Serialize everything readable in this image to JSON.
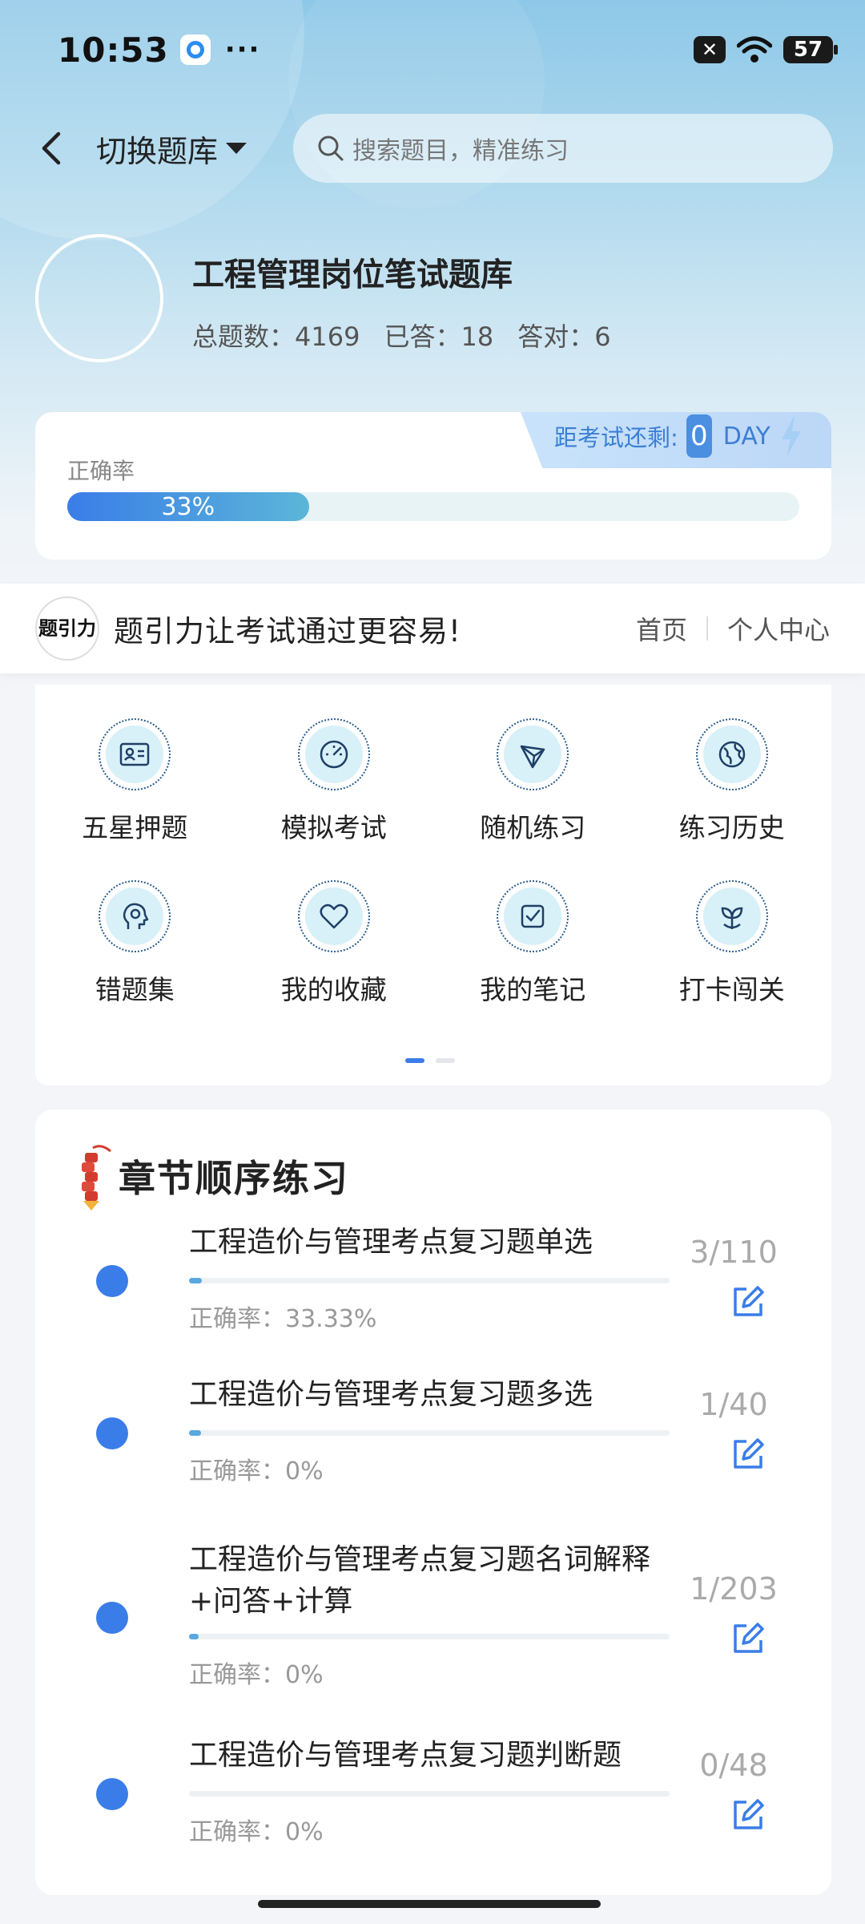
{
  "status": {
    "time": "10:53",
    "dots": "···",
    "battery": "57"
  },
  "nav": {
    "switch_label": "切换题库",
    "search_placeholder": "搜索题目，精准练习"
  },
  "bank": {
    "title": "工程管理岗位笔试题库",
    "total_label": "总题数：4169",
    "answered_label": "已答：18",
    "correct_label": "答对：6"
  },
  "accuracy": {
    "label": "正确率",
    "value_text": "33%",
    "value": 0.33,
    "countdown_label": "距考试还剩:",
    "countdown_num": "0",
    "countdown_unit": "DAY"
  },
  "brand": {
    "logo_text": "题引力",
    "slogan": "题引力让考试通过更容易!",
    "home": "首页",
    "personal": "个人中心"
  },
  "features": [
    {
      "label": "五星押题",
      "icon": "id-card-icon"
    },
    {
      "label": "模拟考试",
      "icon": "gauge-icon"
    },
    {
      "label": "随机练习",
      "icon": "network-icon"
    },
    {
      "label": "练习历史",
      "icon": "globe-icon"
    },
    {
      "label": "错题集",
      "icon": "head-icon"
    },
    {
      "label": "我的收藏",
      "icon": "heart-icon"
    },
    {
      "label": "我的笔记",
      "icon": "note-check-icon"
    },
    {
      "label": "打卡闯关",
      "icon": "sprout-icon"
    }
  ],
  "chapters_title": "章节顺序练习",
  "chapters": [
    {
      "name": "工程造价与管理考点复习题单选",
      "rate": "正确率：33.33%",
      "count": "3/110",
      "progress": 0.027
    },
    {
      "name": "工程造价与管理考点复习题多选",
      "rate": "正确率：0%",
      "count": "1/40",
      "progress": 0.025
    },
    {
      "name": "工程造价与管理考点复习题名词解释+问答+计算",
      "rate": "正确率：0%",
      "count": "1/203",
      "progress": 0.005
    },
    {
      "name": "工程造价与管理考点复习题判断题",
      "rate": "正确率：0%",
      "count": "0/48",
      "progress": 0
    }
  ]
}
